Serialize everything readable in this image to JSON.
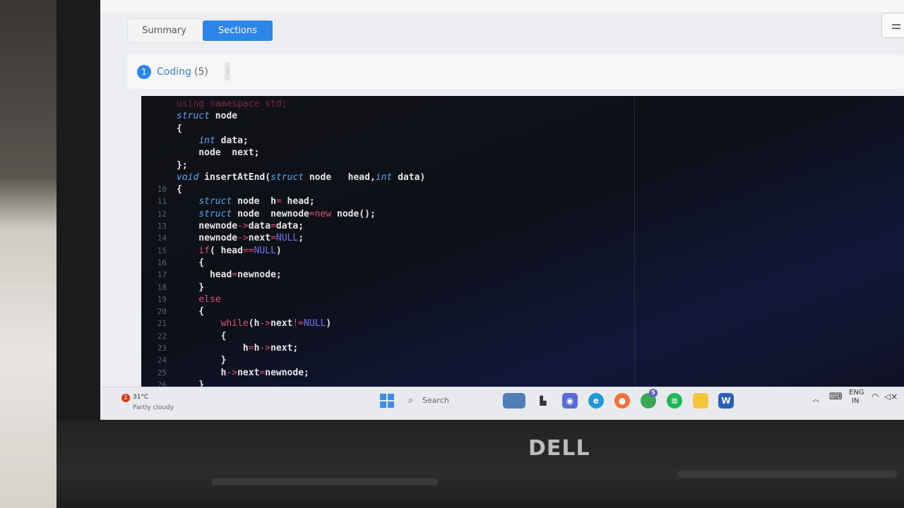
{
  "tabs": {
    "summary": "Summary",
    "sections": "Sections"
  },
  "section_bar": {
    "number": "1",
    "label": "Coding",
    "count": "(5)"
  },
  "editor": {
    "lines": [
      {
        "n": "",
        "segs": [
          {
            "c": "fade",
            "t": "using namespace std;"
          }
        ]
      },
      {
        "n": "",
        "segs": [
          {
            "c": "kw",
            "t": "struct"
          },
          {
            "c": "",
            "t": " node"
          }
        ]
      },
      {
        "n": "",
        "segs": [
          {
            "c": "",
            "t": "{"
          }
        ]
      },
      {
        "n": "",
        "segs": [
          {
            "c": "",
            "t": "    "
          },
          {
            "c": "kw",
            "t": "int"
          },
          {
            "c": "",
            "t": " data;"
          }
        ]
      },
      {
        "n": "",
        "segs": [
          {
            "c": "",
            "t": "    node  next;"
          }
        ]
      },
      {
        "n": "",
        "segs": [
          {
            "c": "",
            "t": "};"
          }
        ]
      },
      {
        "n": "",
        "segs": [
          {
            "c": "kw",
            "t": "void"
          },
          {
            "c": "",
            "t": " insertAtEnd("
          },
          {
            "c": "kw",
            "t": "struct"
          },
          {
            "c": "",
            "t": " node   head,"
          },
          {
            "c": "kw",
            "t": "int"
          },
          {
            "c": "",
            "t": " data)"
          }
        ]
      },
      {
        "n": "10",
        "segs": [
          {
            "c": "",
            "t": "{"
          }
        ]
      },
      {
        "n": "11",
        "segs": [
          {
            "c": "",
            "t": "    "
          },
          {
            "c": "kw",
            "t": "struct"
          },
          {
            "c": "",
            "t": " node  h"
          },
          {
            "c": "op",
            "t": "="
          },
          {
            "c": "",
            "t": " head;"
          }
        ]
      },
      {
        "n": "12",
        "segs": [
          {
            "c": "",
            "t": "    "
          },
          {
            "c": "kw",
            "t": "struct"
          },
          {
            "c": "",
            "t": " node  newnode"
          },
          {
            "c": "op",
            "t": "="
          },
          {
            "c": "kr",
            "t": "new"
          },
          {
            "c": "",
            "t": " node();"
          }
        ]
      },
      {
        "n": "13",
        "segs": [
          {
            "c": "",
            "t": "    newnode"
          },
          {
            "c": "op",
            "t": "->"
          },
          {
            "c": "",
            "t": "data"
          },
          {
            "c": "op",
            "t": "="
          },
          {
            "c": "",
            "t": "data;"
          }
        ]
      },
      {
        "n": "14",
        "segs": [
          {
            "c": "",
            "t": "    newnode"
          },
          {
            "c": "op",
            "t": "->"
          },
          {
            "c": "",
            "t": "next"
          },
          {
            "c": "op",
            "t": "="
          },
          {
            "c": "cn",
            "t": "NULL"
          },
          {
            "c": "",
            "t": ";"
          }
        ]
      },
      {
        "n": "15",
        "segs": [
          {
            "c": "",
            "t": "    "
          },
          {
            "c": "kr",
            "t": "if"
          },
          {
            "c": "",
            "t": "( head"
          },
          {
            "c": "op",
            "t": "=="
          },
          {
            "c": "cn",
            "t": "NULL"
          },
          {
            "c": "",
            "t": ")"
          }
        ]
      },
      {
        "n": "16",
        "segs": [
          {
            "c": "",
            "t": "    {"
          }
        ]
      },
      {
        "n": "17",
        "segs": [
          {
            "c": "",
            "t": "      head"
          },
          {
            "c": "op",
            "t": "="
          },
          {
            "c": "",
            "t": "newnode;"
          }
        ]
      },
      {
        "n": "18",
        "segs": [
          {
            "c": "",
            "t": "    }"
          }
        ]
      },
      {
        "n": "19",
        "segs": [
          {
            "c": "",
            "t": "    "
          },
          {
            "c": "kr",
            "t": "else"
          }
        ]
      },
      {
        "n": "20",
        "segs": [
          {
            "c": "",
            "t": "    {"
          }
        ]
      },
      {
        "n": "21",
        "segs": [
          {
            "c": "",
            "t": "        "
          },
          {
            "c": "kr",
            "t": "while"
          },
          {
            "c": "",
            "t": "(h"
          },
          {
            "c": "op",
            "t": "->"
          },
          {
            "c": "",
            "t": "next"
          },
          {
            "c": "op",
            "t": "!="
          },
          {
            "c": "cn",
            "t": "NULL"
          },
          {
            "c": "",
            "t": ")"
          }
        ]
      },
      {
        "n": "22",
        "segs": [
          {
            "c": "",
            "t": "        {"
          }
        ]
      },
      {
        "n": "23",
        "segs": [
          {
            "c": "",
            "t": "            h"
          },
          {
            "c": "op",
            "t": "="
          },
          {
            "c": "",
            "t": "h"
          },
          {
            "c": "op",
            "t": "->"
          },
          {
            "c": "",
            "t": "next;"
          }
        ]
      },
      {
        "n": "24",
        "segs": [
          {
            "c": "",
            "t": "        }"
          }
        ]
      },
      {
        "n": "25",
        "segs": [
          {
            "c": "",
            "t": "        h"
          },
          {
            "c": "op",
            "t": "->"
          },
          {
            "c": "",
            "t": "next"
          },
          {
            "c": "op",
            "t": "="
          },
          {
            "c": "",
            "t": "newnode;"
          }
        ]
      },
      {
        "n": "26",
        "segs": [
          {
            "c": "",
            "t": "    }"
          }
        ]
      }
    ]
  },
  "taskbar": {
    "weather_badge": "1",
    "temperature": "31°C",
    "condition": "Partly cloudy",
    "search_label": "Search",
    "chrome_badge": "5",
    "lang": "ENG",
    "region": "IN"
  },
  "brand": "DELL",
  "icons": [
    "settings-sliders-icon",
    "windows-start-icon",
    "search-icon",
    "widgets-icon",
    "files-icon",
    "chat-icon",
    "edge-icon",
    "firefox-icon",
    "chrome-icon",
    "spotify-icon",
    "file-explorer-icon",
    "word-icon",
    "chevron-up-icon",
    "keyboard-icon",
    "wifi-icon",
    "volume-icon"
  ]
}
